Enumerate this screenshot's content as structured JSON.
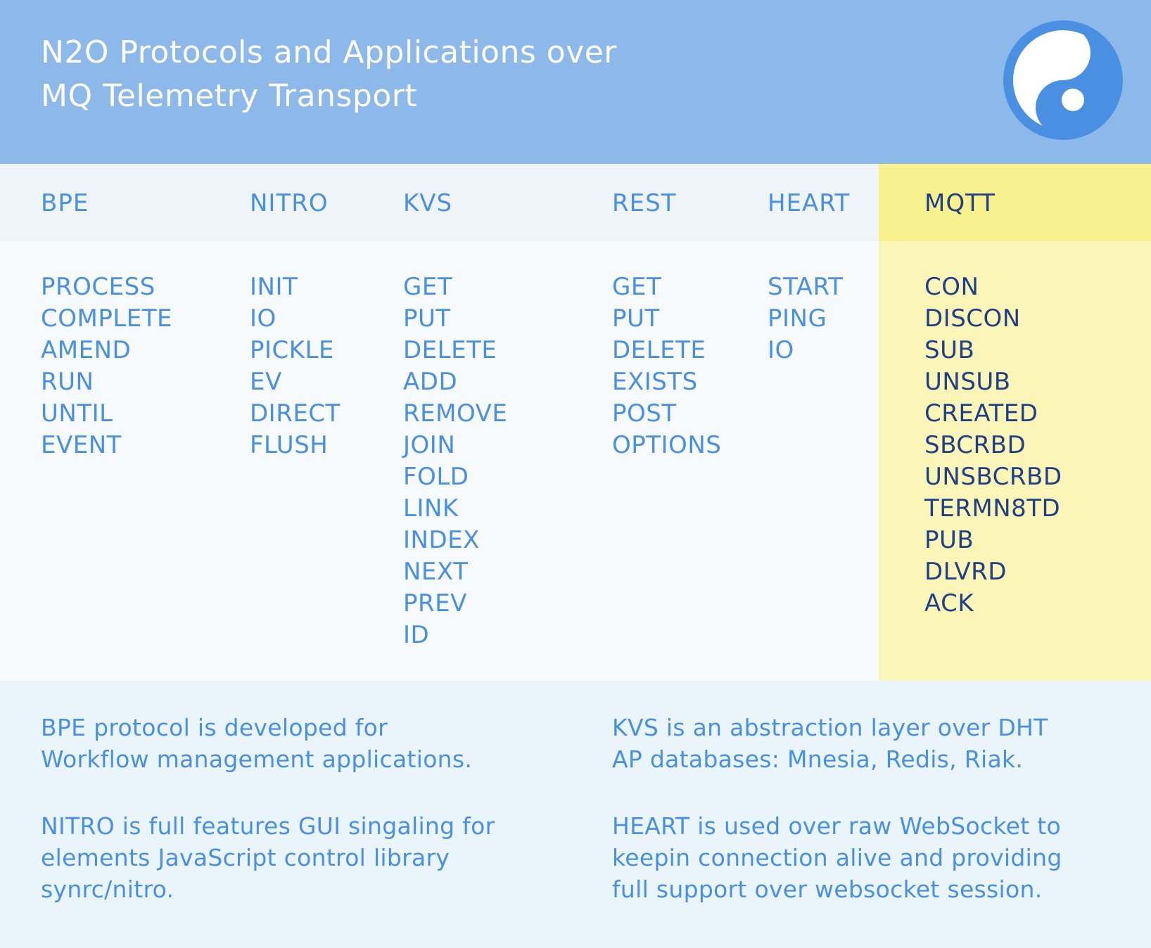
{
  "header": {
    "title_line1": "N2O Protocols and Applications over",
    "title_line2": "MQ Telemetry Transport",
    "logo_icon": "synrc-logo-icon"
  },
  "colors": {
    "header_bg": "#8cb8ea",
    "accent_blue": "#4a90e2",
    "dark_blue": "#1f3f86",
    "highlight_yellow": "#f9f08e",
    "highlight_yellow_light": "#fbf6b8"
  },
  "columns": [
    {
      "name": "BPE",
      "items": [
        "PROCESS",
        "COMPLETE",
        "AMEND",
        "RUN",
        "UNTIL",
        "EVENT"
      ]
    },
    {
      "name": "NITRO",
      "items": [
        "INIT",
        "IO",
        "PICKLE",
        "EV",
        "DIRECT",
        "FLUSH"
      ]
    },
    {
      "name": "KVS",
      "items": [
        "GET",
        "PUT",
        "DELETE",
        "ADD",
        "REMOVE",
        "JOIN",
        "FOLD",
        "LINK",
        "INDEX",
        "NEXT",
        "PREV",
        "ID"
      ]
    },
    {
      "name": "REST",
      "items": [
        "GET",
        "PUT",
        "DELETE",
        "EXISTS",
        "POST",
        "OPTIONS"
      ]
    },
    {
      "name": "HEART",
      "items": [
        "START",
        "PING",
        "IO"
      ]
    },
    {
      "name": "MQTT",
      "highlighted": true,
      "items": [
        "CON",
        "DISCON",
        "SUB",
        "UNSUB",
        "CREATED",
        "SBCRBD",
        "UNSBCRBD",
        "TERMN8TD",
        "PUB",
        "DLVRD",
        "ACK"
      ]
    }
  ],
  "notes": {
    "bpe": [
      "BPE protocol is developed for",
      "Workflow management applications."
    ],
    "nitro": [
      "NITRO is full features GUI singaling for",
      "elements JavaScript control library",
      "synrc/nitro."
    ],
    "kvs": [
      "KVS is an abstraction layer over DHT",
      "AP databases: Mnesia, Redis, Riak."
    ],
    "heart": [
      "HEART is used over raw WebSocket to",
      "keepin connection alive and providing",
      "full support over websocket session."
    ]
  }
}
